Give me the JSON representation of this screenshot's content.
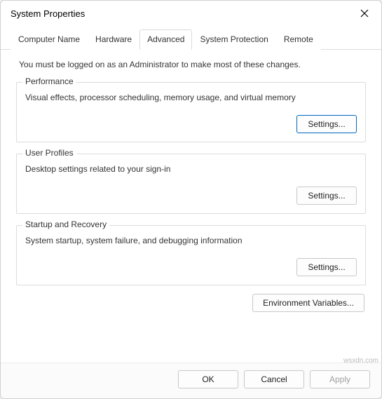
{
  "window": {
    "title": "System Properties"
  },
  "tabs": {
    "computer_name": "Computer Name",
    "hardware": "Hardware",
    "advanced": "Advanced",
    "system_protection": "System Protection",
    "remote": "Remote"
  },
  "advanced_panel": {
    "intro": "You must be logged on as an Administrator to make most of these changes.",
    "performance": {
      "legend": "Performance",
      "desc": "Visual effects, processor scheduling, memory usage, and virtual memory",
      "button": "Settings..."
    },
    "user_profiles": {
      "legend": "User Profiles",
      "desc": "Desktop settings related to your sign-in",
      "button": "Settings..."
    },
    "startup_recovery": {
      "legend": "Startup and Recovery",
      "desc": "System startup, system failure, and debugging information",
      "button": "Settings..."
    },
    "env_vars_button": "Environment Variables..."
  },
  "dialog_buttons": {
    "ok": "OK",
    "cancel": "Cancel",
    "apply": "Apply"
  },
  "watermark": "wsxdn.com"
}
